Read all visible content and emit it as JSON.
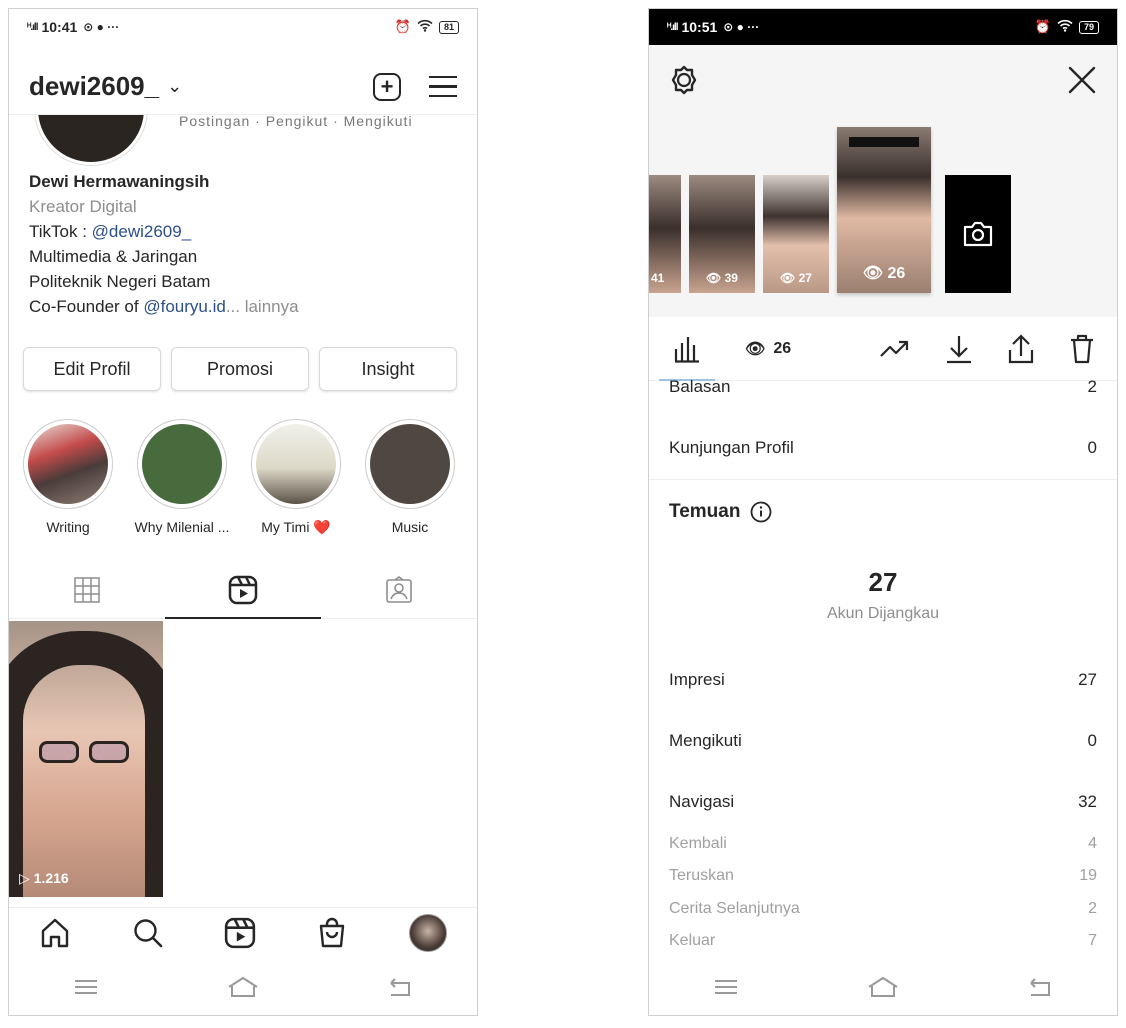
{
  "left": {
    "status": {
      "time": "10:41",
      "signal": "ᴴ.ıll",
      "battery": "81"
    },
    "header": {
      "username": "dewi2609_"
    },
    "stat_labels": "Postingan · Pengikut · Mengikuti",
    "bio": {
      "name": "Dewi Hermawaningsih",
      "category": "Kreator Digital",
      "tiktok_prefix": "TikTok : ",
      "tiktok_handle": "@dewi2609_",
      "line3": "Multimedia & Jaringan",
      "line4": "Politeknik Negeri Batam",
      "cofounder_prefix": "Co-Founder of ",
      "cofounder_link": "@fouryu.id",
      "more": "... lainnya"
    },
    "buttons": {
      "edit": "Edit Profil",
      "promo": "Promosi",
      "insight": "Insight"
    },
    "highlights": [
      {
        "label": "Writing"
      },
      {
        "label": "Why Milenial ..."
      },
      {
        "label": "My Timi ❤️"
      },
      {
        "label": "Music"
      }
    ],
    "reel": {
      "views": "1.216"
    }
  },
  "right": {
    "status": {
      "time": "10:51",
      "signal": "ᴴ.ıll",
      "battery": "79"
    },
    "thumbs": [
      {
        "views": "41"
      },
      {
        "views": "39"
      },
      {
        "views": "27"
      },
      {
        "views": "26"
      }
    ],
    "toolbar": {
      "views": "26"
    },
    "rows_top": [
      {
        "label": "Balasan",
        "value": "2"
      },
      {
        "label": "Kunjungan Profil",
        "value": "0"
      }
    ],
    "temuan": {
      "title": "Temuan",
      "reach_value": "27",
      "reach_label": "Akun Dijangkau"
    },
    "rows": [
      {
        "label": "Impresi",
        "value": "27"
      },
      {
        "label": "Mengikuti",
        "value": "0"
      },
      {
        "label": "Navigasi",
        "value": "32"
      }
    ],
    "sub_rows": [
      {
        "label": "Kembali",
        "value": "4"
      },
      {
        "label": "Teruskan",
        "value": "19"
      },
      {
        "label": "Cerita Selanjutnya",
        "value": "2"
      },
      {
        "label": "Keluar",
        "value": "7"
      }
    ]
  }
}
